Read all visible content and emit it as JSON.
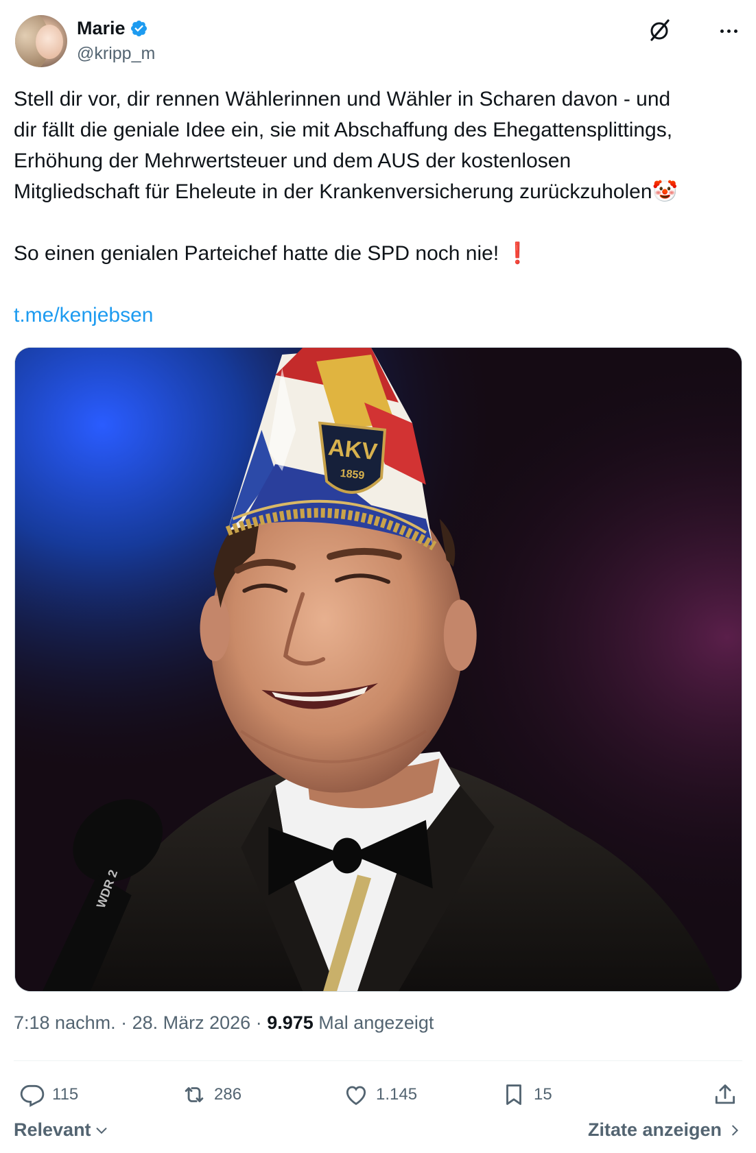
{
  "author": {
    "display_name": "Marie",
    "handle": "@kripp_m",
    "verified": true
  },
  "tweet": {
    "lines": [
      "Stell dir vor, dir rennen Wählerinnen und Wähler in Scharen davon - und",
      "dir fällt die geniale Idee ein, sie mit Abschaffung des Ehegattensplittings,",
      "Erhöhung der Mehrwertsteuer und dem AUS der kostenlosen",
      "Mitgliedschaft für Eheleute in der Krankenversicherung zurückzuholen"
    ],
    "line_emoji": "🤡",
    "second_paragraph": "So einen genialen Parteichef hatte die SPD noch nie!",
    "second_emoji": "❗",
    "link": "t.me/kenjebsen"
  },
  "media": {
    "hat_badge": "AKV",
    "hat_badge_year": "1859",
    "mic_text": "WDR 2"
  },
  "meta": {
    "time": "7:18 nachm.",
    "date": "28. März 2026",
    "views_count": "9.975",
    "views_label": "Mal angezeigt"
  },
  "actions": {
    "replies": "115",
    "reposts": "286",
    "likes": "1.145",
    "bookmarks": "15"
  },
  "footer": {
    "sort_label": "Relevant",
    "quotes_label": "Zitate anzeigen"
  },
  "colors": {
    "accent": "#1d9bf0",
    "text": "#0f1419",
    "secondary": "#536471",
    "divider": "#eff3f4"
  },
  "icons": [
    "verified-icon",
    "grok-icon",
    "more-icon",
    "reply-icon",
    "repost-icon",
    "like-icon",
    "bookmark-icon",
    "share-icon",
    "chevron-down-icon",
    "chevron-right-icon"
  ]
}
